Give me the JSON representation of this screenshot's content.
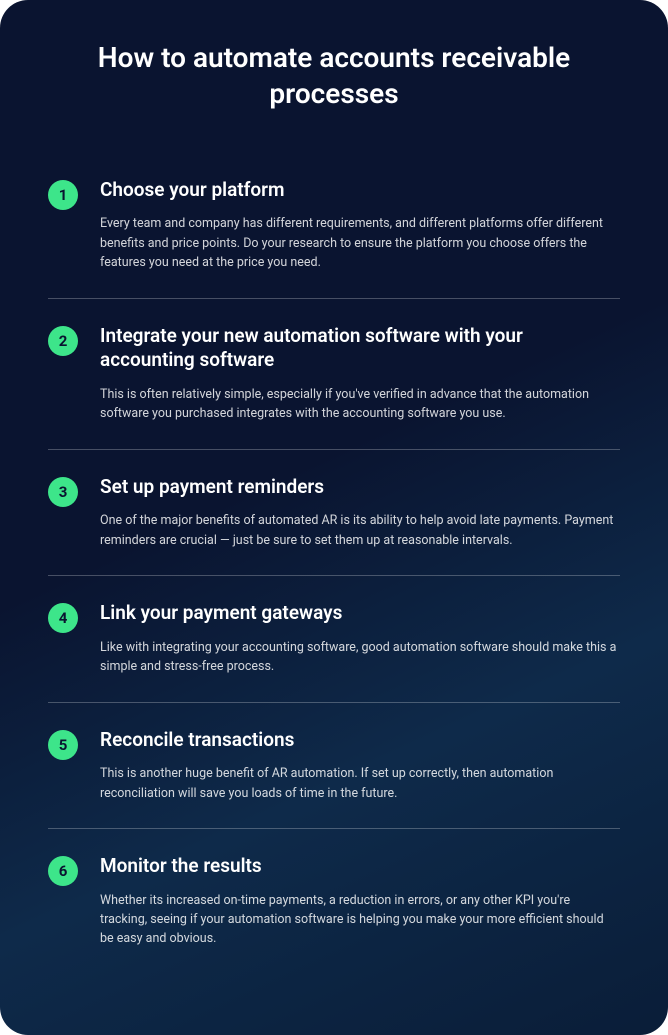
{
  "title": "How to automate accounts receivable processes",
  "steps": [
    {
      "num": "1",
      "title": "Choose your platform",
      "desc": "Every team and company has different requirements, and different platforms offer different benefits and price points. Do your research to ensure the platform you choose offers the features you need at the price you need."
    },
    {
      "num": "2",
      "title": "Integrate your new automation software with your accounting software",
      "desc": "This is often relatively simple, especially if you've verified in advance that the automation software you purchased integrates with the accounting software you use."
    },
    {
      "num": "3",
      "title": "Set up payment reminders",
      "desc": "One of the major benefits of automated AR is its ability to help avoid late payments. Payment reminders are crucial — just be sure to set them up at reasonable intervals."
    },
    {
      "num": "4",
      "title": "Link your payment gateways",
      "desc": "Like with integrating your accounting software, good automation software should make this a simple and stress-free process."
    },
    {
      "num": "5",
      "title": "Reconcile transactions",
      "desc": "This is another huge benefit of AR automation. If set up correctly, then automation reconciliation will save you loads of time in the future."
    },
    {
      "num": "6",
      "title": "Monitor the results",
      "desc": "Whether its increased on-time payments, a reduction in errors, or any other KPI you're tracking, seeing if your automation software is helping you make your more efficient should be easy and obvious."
    }
  ]
}
